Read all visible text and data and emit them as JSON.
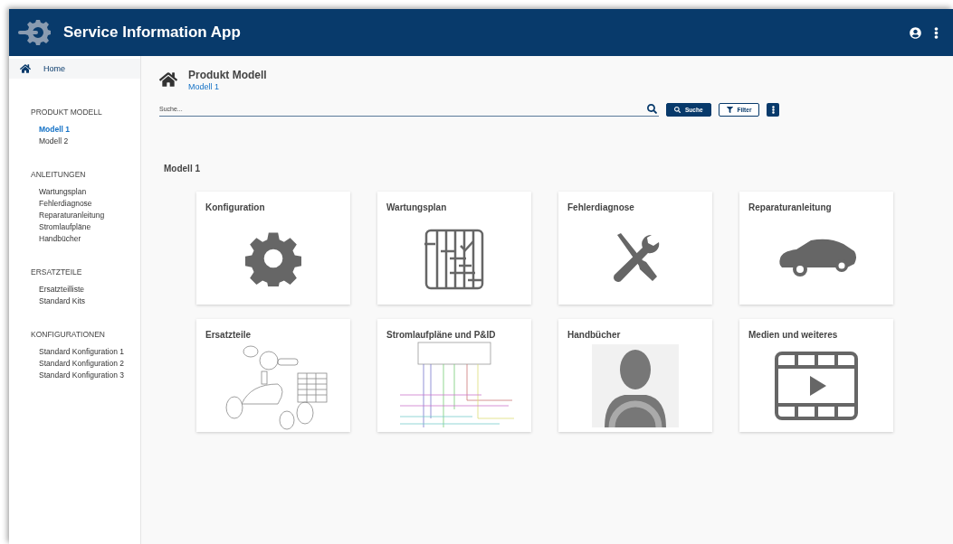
{
  "header": {
    "title": "Service Information App"
  },
  "sidebar": {
    "home": "Home",
    "sections": [
      {
        "title": "PRODUKT MODELL",
        "items": [
          {
            "label": "Modell 1",
            "selected": true
          },
          {
            "label": "Modell 2",
            "selected": false
          }
        ]
      },
      {
        "title": "ANLEITUNGEN",
        "items": [
          {
            "label": "Wartungsplan",
            "selected": false
          },
          {
            "label": "Fehlerdiagnose",
            "selected": false
          },
          {
            "label": "Reparaturanleitung",
            "selected": false
          },
          {
            "label": "Stromlaufpläne",
            "selected": false
          },
          {
            "label": "Handbücher",
            "selected": false
          }
        ]
      },
      {
        "title": "ERSATZTEILE",
        "items": [
          {
            "label": "Ersatzteilliste",
            "selected": false
          },
          {
            "label": "Standard Kits",
            "selected": false
          }
        ]
      },
      {
        "title": "KONFIGURATIONEN",
        "items": [
          {
            "label": "Standard Konfiguration 1",
            "selected": false
          },
          {
            "label": "Standard Konfiguration 2",
            "selected": false
          },
          {
            "label": "Standard Konfiguration 3",
            "selected": false
          }
        ]
      }
    ]
  },
  "page": {
    "title": "Produkt Modell",
    "breadcrumb": "Modell 1"
  },
  "search": {
    "placeholder": "Suche...",
    "search_button": "Suche",
    "filter_button": "Filter"
  },
  "section_title": "Modell 1",
  "cards": [
    {
      "title": "Konfiguration",
      "kind": "gear"
    },
    {
      "title": "Wartungsplan",
      "kind": "plan"
    },
    {
      "title": "Fehlerdiagnose",
      "kind": "tools"
    },
    {
      "title": "Reparaturanleitung",
      "kind": "car"
    },
    {
      "title": "Ersatzteile",
      "kind": "parts"
    },
    {
      "title": "Stromlaufpläne und P&ID",
      "kind": "wiring"
    },
    {
      "title": "Handbücher",
      "kind": "driver"
    },
    {
      "title": "Medien und weiteres",
      "kind": "video"
    }
  ]
}
